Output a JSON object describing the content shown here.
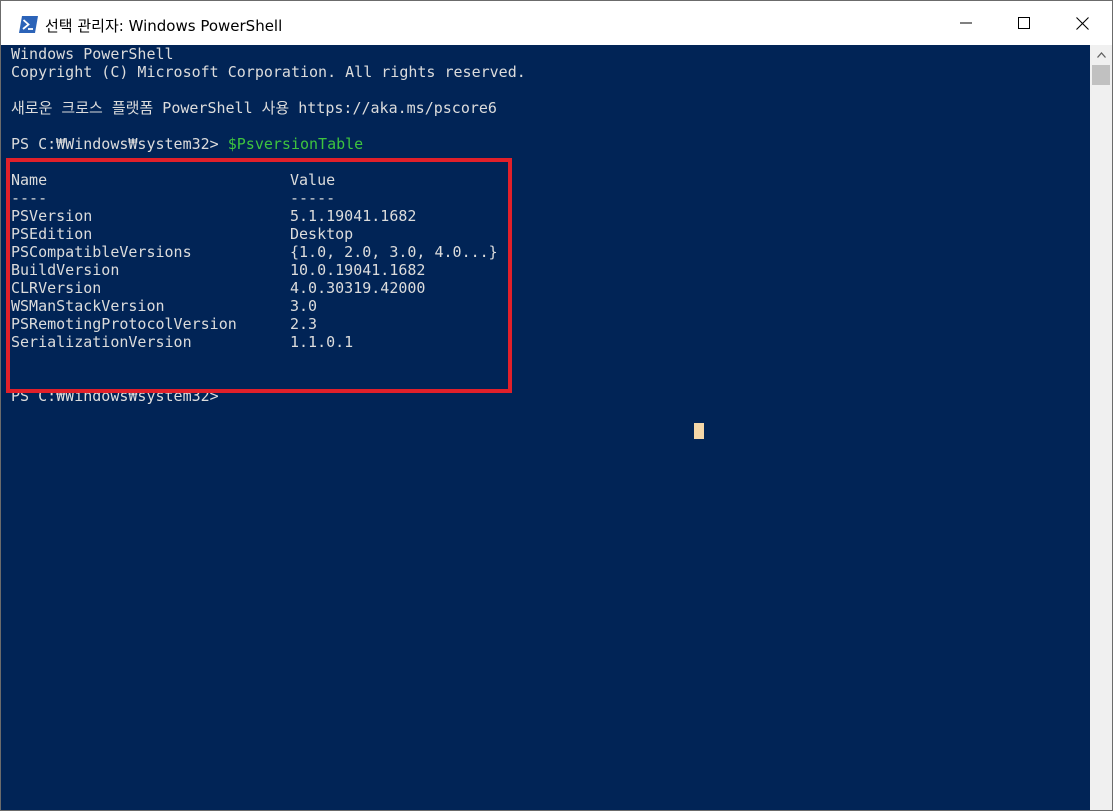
{
  "window": {
    "title": "선택 관리자: Windows PowerShell",
    "icon": "powershell-icon",
    "controls": {
      "minimize": "minimize-icon",
      "maximize": "maximize-icon",
      "close": "close-icon"
    }
  },
  "console": {
    "banner": [
      "Windows PowerShell",
      "Copyright (C) Microsoft Corporation. All rights reserved."
    ],
    "core_notice": "새로운 크로스 플랫폼 PowerShell 사용 https://aka.ms/pscore6",
    "prompt1": "PS C:₩Windows₩system32> ",
    "command": "$PsversionTable",
    "table": {
      "headers": [
        "Name",
        "Value"
      ],
      "separators": [
        "----",
        "-----"
      ],
      "rows": [
        [
          "PSVersion",
          "5.1.19041.1682"
        ],
        [
          "PSEdition",
          "Desktop"
        ],
        [
          "PSCompatibleVersions",
          "{1.0, 2.0, 3.0, 4.0...}"
        ],
        [
          "BuildVersion",
          "10.0.19041.1682"
        ],
        [
          "CLRVersion",
          "4.0.30319.42000"
        ],
        [
          "WSManStackVersion",
          "3.0"
        ],
        [
          "PSRemotingProtocolVersion",
          "2.3"
        ],
        [
          "SerializationVersion",
          "1.1.0.1"
        ]
      ]
    },
    "prompt2": "PS C:₩Windows₩system32>"
  },
  "colors": {
    "console_background": "#012456",
    "console_text": "#dcdcdc",
    "command_text": "#3ec43e",
    "highlight_border": "#e1202a",
    "cursor": "#f4d7a8"
  }
}
